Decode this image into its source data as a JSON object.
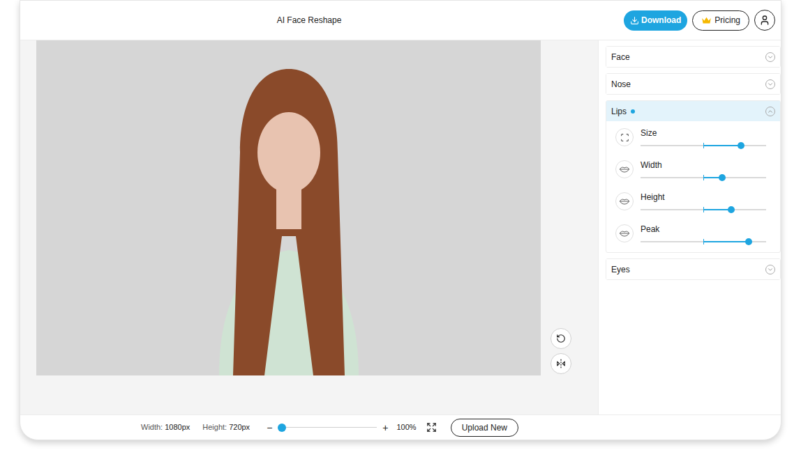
{
  "app": {
    "title": "AI Face Reshape"
  },
  "header": {
    "download": "Download",
    "pricing": "Pricing"
  },
  "panel": {
    "sections": [
      {
        "label": "Face",
        "expanded": false,
        "modified": false,
        "sliders": []
      },
      {
        "label": "Nose",
        "expanded": false,
        "modified": false,
        "sliders": []
      },
      {
        "label": "Lips",
        "expanded": true,
        "modified": true,
        "sliders": [
          {
            "label": "Size",
            "level": 0.8,
            "kind": "size"
          },
          {
            "label": "Width",
            "level": 0.65,
            "kind": "lips"
          },
          {
            "label": "Height",
            "level": 0.72,
            "kind": "lips"
          },
          {
            "label": "Peak",
            "level": 0.86,
            "kind": "lips"
          }
        ]
      },
      {
        "label": "Eyes",
        "expanded": false,
        "modified": false,
        "sliders": []
      }
    ]
  },
  "status_bar": {
    "width_label": "Width:",
    "width_value": "1080px",
    "height_label": "Height:",
    "height_value": "720px",
    "zoom_out": "−",
    "zoom_in": "+",
    "zoom_level": 0.04,
    "zoom": "100%",
    "upload": "Upload New"
  }
}
